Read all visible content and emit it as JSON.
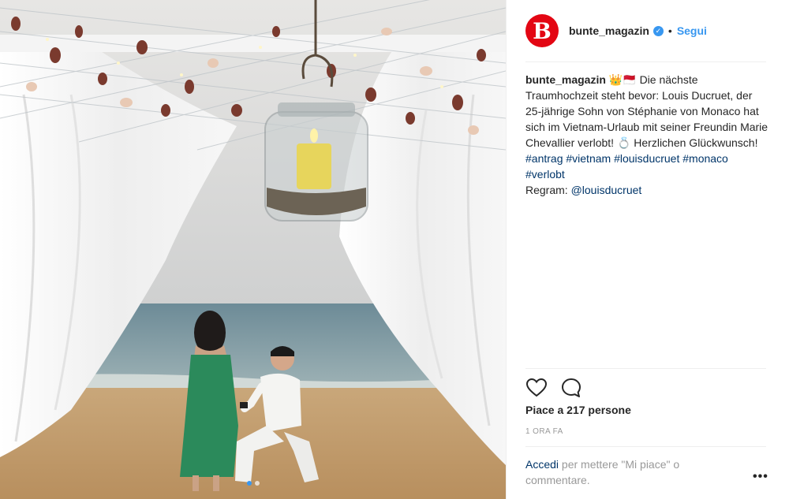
{
  "header": {
    "avatar_letter": "B",
    "username": "bunte_magazin",
    "verified_mark": "✓",
    "separator": "•",
    "follow_label": "Segui"
  },
  "caption": {
    "user": "bunte_magazin",
    "emojis": "👑🇲🇨",
    "text_1": "Die nächste Traumhochzeit steht bevor: Louis Ducruet, der 25-jährige Sohn von Stéphanie von Monaco hat sich im Vietnam-Urlaub mit seiner Freundin Marie Chevallier verlobt!",
    "ring_emoji": "💍",
    "text_2": "Herzlichen Glückwunsch!",
    "tags": [
      "#antrag",
      "#vietnam",
      "#louisducruet",
      "#monaco",
      "#verlobt"
    ],
    "regram_label": "Regram:",
    "mention": "@louisducruet"
  },
  "actions": {
    "like_icon": "heart-icon",
    "comment_icon": "comment-icon"
  },
  "likes_text": "Piace a 217 persone",
  "time_text": "1 ORA FA",
  "comment_prompt": {
    "login_label": "Accedi",
    "rest": "per mettere \"Mi piace\" o commentare."
  },
  "more_label": "•••",
  "carousel": {
    "dots": 2,
    "active_index": 0
  },
  "colors": {
    "accent_blue": "#3897f0",
    "link_dark": "#003569",
    "brand_red": "#e30613"
  }
}
